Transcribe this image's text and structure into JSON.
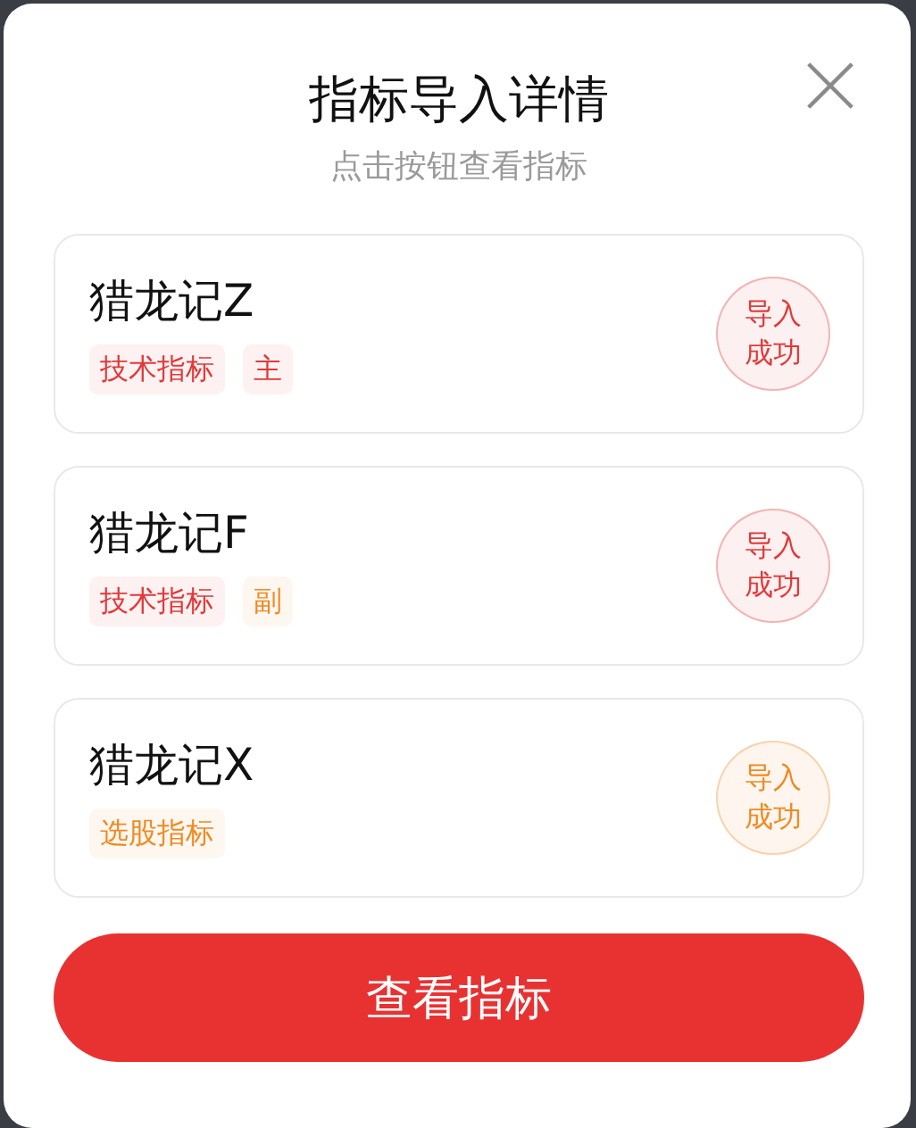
{
  "dialog": {
    "title": "指标导入详情",
    "subtitle": "点击按钮查看指标"
  },
  "indicators": [
    {
      "name": "猎龙记Z",
      "tags": [
        {
          "label": "技术指标",
          "color": "#e03a3a"
        },
        {
          "label": "主",
          "color": "#e03a3a"
        }
      ],
      "status": {
        "label": "导入成功",
        "color": "#e03a3a"
      }
    },
    {
      "name": "猎龙记F",
      "tags": [
        {
          "label": "技术指标",
          "color": "#e03a3a"
        },
        {
          "label": "副",
          "color": "#f08a24"
        }
      ],
      "status": {
        "label": "导入成功",
        "color": "#e03a3a"
      }
    },
    {
      "name": "猎龙记X",
      "tags": [
        {
          "label": "选股指标",
          "color": "#f08a24"
        }
      ],
      "status": {
        "label": "导入成功",
        "color": "#f08a24"
      }
    }
  ],
  "primary_button": {
    "label": "查看指标"
  }
}
